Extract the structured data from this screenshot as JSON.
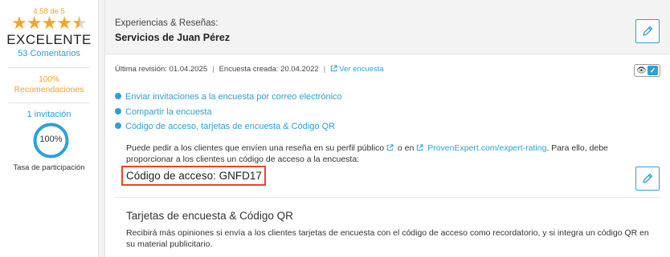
{
  "sidebar": {
    "rating_text": "4,58 de 5",
    "rating_word": "EXCELENTE",
    "comments_link": "53 Comentarios",
    "recommendations_pct": "100%",
    "recommendations_label": "Recomendaciones",
    "invitations_link": "1 invitación",
    "participation_pct": "100%",
    "participation_label": "Tasa de participación",
    "stars": {
      "value": 4.58,
      "max": 5
    },
    "colors": {
      "accent": "#2e9fd8",
      "stars": "#f4a52c",
      "orange_text": "#f0a030"
    }
  },
  "header": {
    "section_label": "Experiencias & Reseñas:",
    "title": "Servicios de Juan Pérez"
  },
  "meta": {
    "last_revision": "Última revisión: 01.04.2025",
    "survey_created": "Encuesta creada: 20.04.2022",
    "view_survey_link": "Ver encuesta"
  },
  "options": [
    {
      "label": "Enviar invitaciones a la encuesta por correo electrónico"
    },
    {
      "label": "Compartir la encuesta"
    },
    {
      "label": "Código de acceso, tarjetas de encuesta & Código QR"
    }
  ],
  "access": {
    "desc_part1": "Puede pedir a los clientes que envíen una reseña en su perfil público",
    "desc_part2": "o en",
    "desc_link": "ProvenExpert.com/expert-rating",
    "desc_part3": ". Para ello, debe proporcionar a los clientes un código de acceso a la encuesta:",
    "code_text": "Código de acceso: GNFD17"
  },
  "cards": {
    "title": "Tarjetas de encuesta & Código QR",
    "description": "Recibirá más opiniones si envía a los clientes tarjetas de encuesta con el código de acceso como recordatorio, y si integra un código QR en su material publicitario."
  },
  "icons": {
    "edit": "pencil-icon",
    "external": "external-link-icon",
    "eye": "eye-icon",
    "check": "checkbox-checked-icon",
    "bullet": "bullet-dot-icon"
  }
}
